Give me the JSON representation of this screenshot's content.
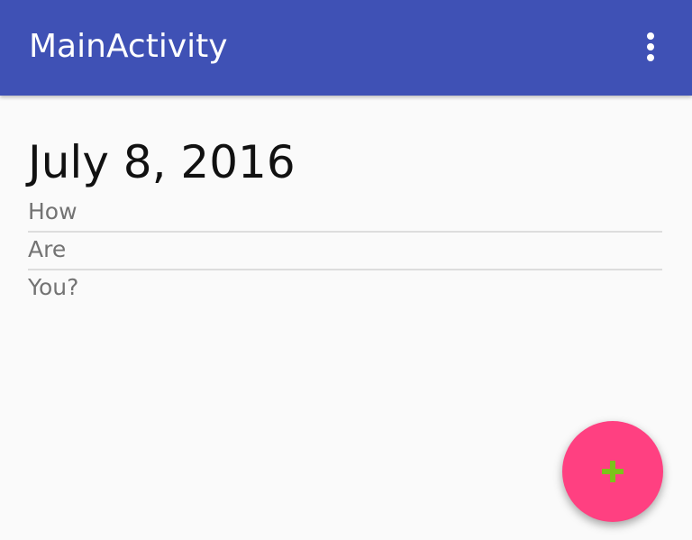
{
  "app_bar": {
    "title": "MainActivity",
    "menu_icon": "more-vert-icon",
    "background": "#3f51b5"
  },
  "main": {
    "date_heading": "July 8, 2016",
    "items": [
      {
        "text": "How"
      },
      {
        "text": "Are"
      },
      {
        "text": "You?"
      }
    ]
  },
  "fab": {
    "icon": "plus-icon",
    "background": "#ff4081",
    "icon_color": "#7cc31a"
  }
}
